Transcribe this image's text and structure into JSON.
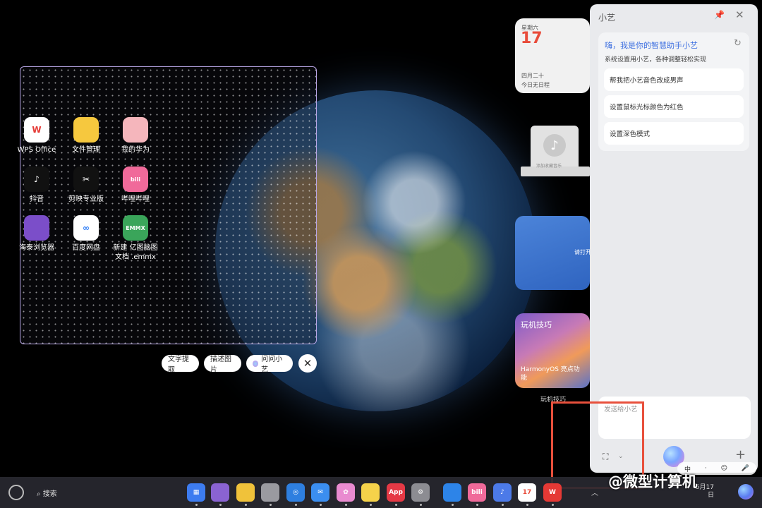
{
  "selection_apps": [
    {
      "label": "WPS Office",
      "icon": "wps-office-icon",
      "color": "#ffffff",
      "glyph": "W",
      "glyph_color": "#e53935"
    },
    {
      "label": "文件管理",
      "icon": "file-manager-icon",
      "color": "#f6c83e",
      "glyph": "",
      "glyph_color": "#fff"
    },
    {
      "label": "我的华为",
      "icon": "my-huawei-icon",
      "color": "#f5b6bc",
      "glyph": "",
      "glyph_color": "#fff"
    },
    {
      "label": "抖音",
      "icon": "douyin-icon",
      "color": "#111111",
      "glyph": "♪",
      "glyph_color": "#fff"
    },
    {
      "label": "剪映专业版",
      "icon": "jianying-icon",
      "color": "#111111",
      "glyph": "✂",
      "glyph_color": "#fff"
    },
    {
      "label": "哔哩哔哩",
      "icon": "bilibili-icon",
      "color": "#f06a9a",
      "glyph": "bili",
      "glyph_color": "#fff"
    },
    {
      "label": "海泰浏览器",
      "icon": "haitai-browser-icon",
      "color": "#7b4ec9",
      "glyph": "",
      "glyph_color": "#fff"
    },
    {
      "label": "百度网盘",
      "icon": "baidu-netdisk-icon",
      "color": "#ffffff",
      "glyph": "∞",
      "glyph_color": "#2d7cf6"
    },
    {
      "label": "新建 亿图脑图文档 .emmx",
      "icon": "emmx-file-icon",
      "color": "#3aa55a",
      "glyph": "EMMX",
      "glyph_color": "#fff"
    }
  ],
  "actions": {
    "text_extract": "文字提取",
    "describe_image": "描述图片",
    "ask_xiaoyi": "问问小艺"
  },
  "calendar_widget": {
    "weekday": "星期六",
    "day": "17",
    "lunar": "四月二十",
    "events": "今日无日程"
  },
  "music_widget": {
    "text": "添加收藏音乐"
  },
  "blue_widget": {
    "text": "请打开"
  },
  "tips_widget": {
    "header": "玩机技巧",
    "body": "HarmonyOS 亮点功能",
    "label": "玩机技巧"
  },
  "assistant_panel": {
    "title": "小艺",
    "greeting": "嗨，我是你的智慧助手小艺",
    "subtitle": "系统设置用小艺，各种调整轻松实现",
    "suggestions": [
      "帮我把小艺音色改成男声",
      "设置鼠标光标颜色为红色",
      "设置深色模式"
    ],
    "input_placeholder": "发送给小艺"
  },
  "taskbar": {
    "search": "搜索",
    "dock_icons": [
      {
        "name": "app-grid-icon",
        "color": "#3d7cf0",
        "glyph": "▦"
      },
      {
        "name": "gallery-app-icon",
        "color": "#8a63d2",
        "glyph": ""
      },
      {
        "name": "notes-icon",
        "color": "#f0c23a",
        "glyph": ""
      },
      {
        "name": "trash-icon",
        "color": "#9a9aa0",
        "glyph": ""
      },
      {
        "name": "browser-icon",
        "color": "#2e7fe0",
        "glyph": "◎"
      },
      {
        "name": "mail-icon",
        "color": "#3b8ef0",
        "glyph": "✉"
      },
      {
        "name": "photos-icon",
        "color": "#e98bd0",
        "glyph": "✿"
      },
      {
        "name": "memo-icon",
        "color": "#f5d24a",
        "glyph": ""
      },
      {
        "name": "app-gallery-icon",
        "color": "#e53945",
        "glyph": "App"
      },
      {
        "name": "settings-icon",
        "color": "#8c8c92",
        "glyph": "⚙"
      },
      {
        "name": "files-icon",
        "color": "#2d84e8",
        "glyph": ""
      },
      {
        "name": "bilibili-dock-icon",
        "color": "#f06a9a",
        "glyph": "bili"
      },
      {
        "name": "music-icon",
        "color": "#4c7ae8",
        "glyph": "♪"
      },
      {
        "name": "calendar-dock-icon",
        "color": "#ffffff",
        "glyph": "17"
      },
      {
        "name": "wps-dock-icon",
        "color": "#e53935",
        "glyph": "W"
      }
    ],
    "ime": [
      "中",
      "·",
      "☺",
      "🎤"
    ],
    "clock_date": "5月17日"
  },
  "watermark": "@微型计算机"
}
